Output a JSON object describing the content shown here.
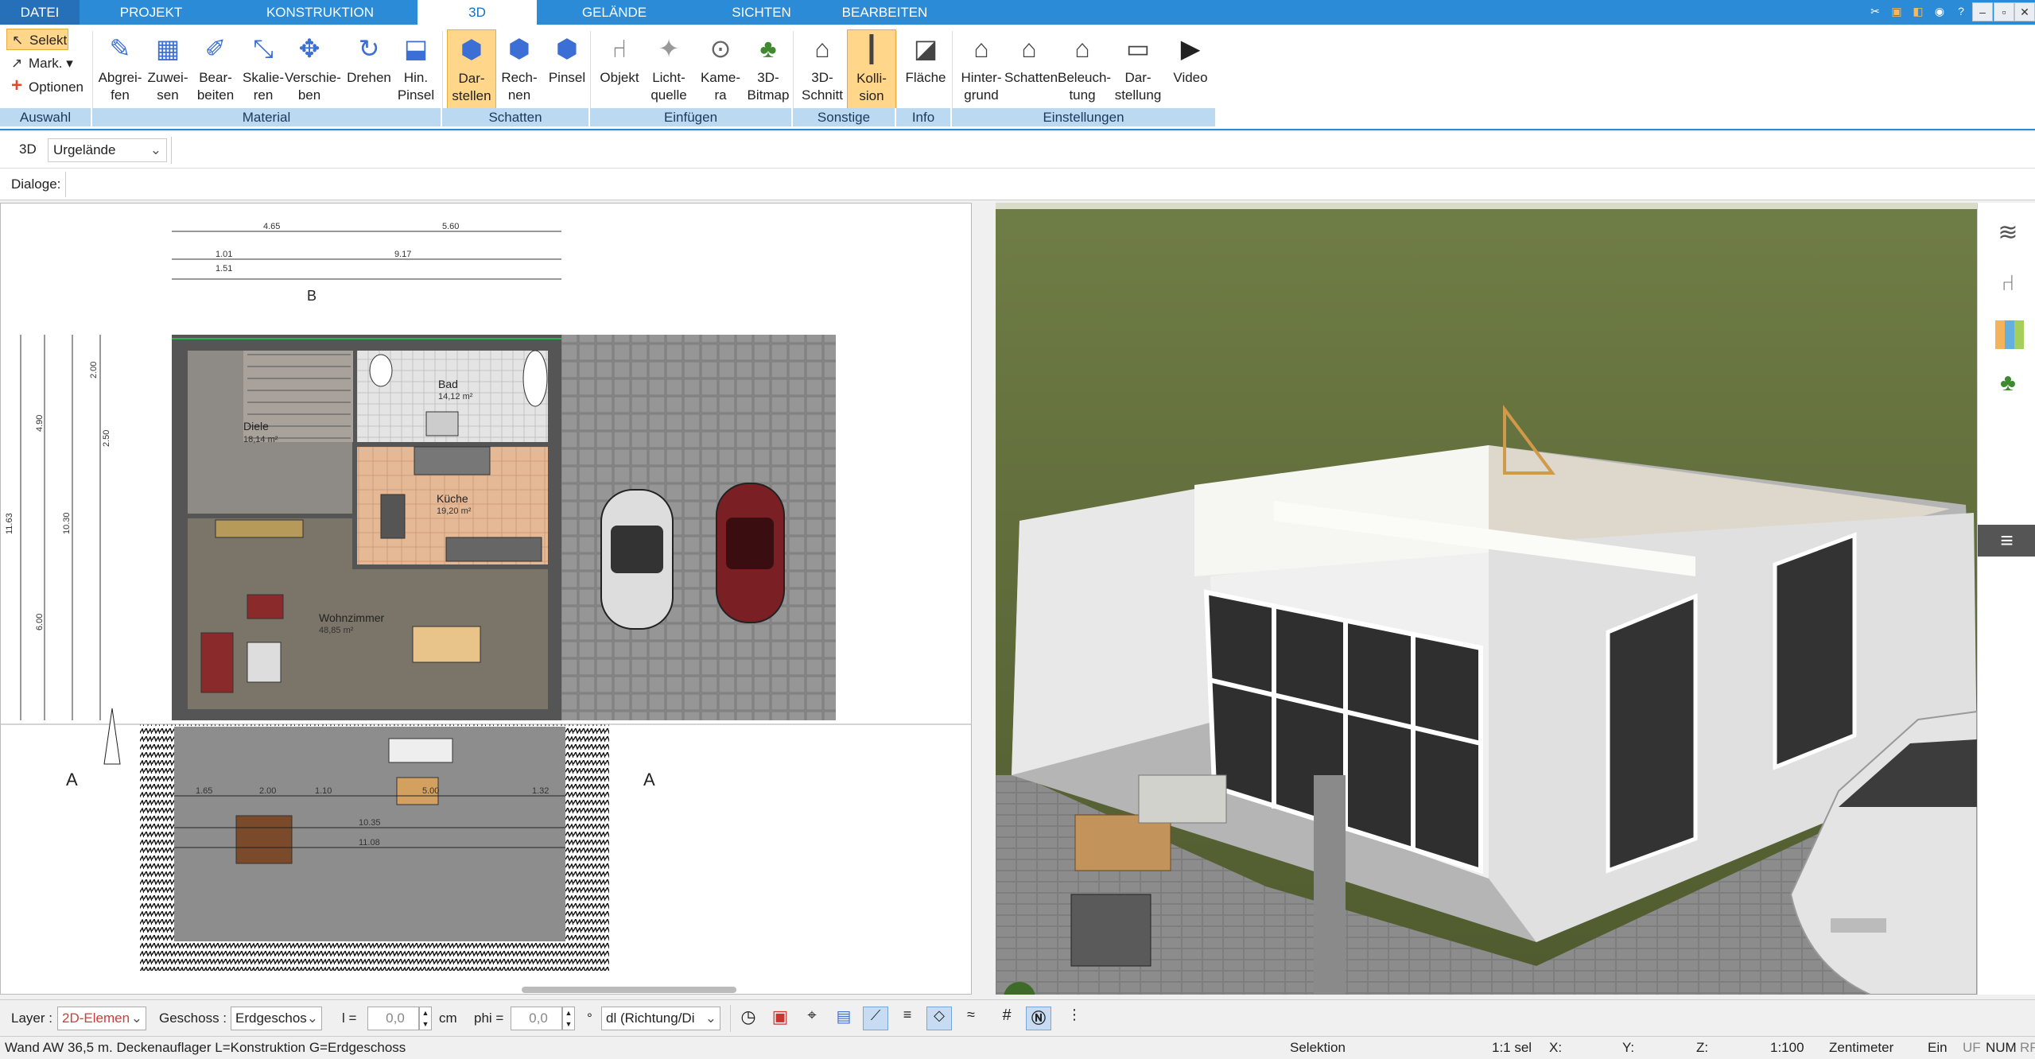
{
  "menu": {
    "tabs": [
      "DATEI",
      "PROJEKT",
      "KONSTRUKTION",
      "3D",
      "GELÄNDE",
      "SICHTEN",
      "BEARBEITEN"
    ],
    "active": "3D"
  },
  "quick_tools": {
    "select": "Selekt",
    "mark": "Mark.",
    "options": "Optionen"
  },
  "ribbon": {
    "buttons": [
      {
        "label1": "Abgrei-",
        "label2": "fen",
        "icon": "eyedropper-icon"
      },
      {
        "label1": "Zuwei-",
        "label2": "sen",
        "icon": "assign-material-icon"
      },
      {
        "label1": "Bear-",
        "label2": "beiten",
        "icon": "edit-material-icon"
      },
      {
        "label1": "Skalie-",
        "label2": "ren",
        "icon": "scale-icon"
      },
      {
        "label1": "Verschie-",
        "label2": "ben",
        "icon": "move-icon"
      },
      {
        "label1": "Drehen",
        "label2": "",
        "icon": "rotate-icon"
      },
      {
        "label1": "Hin.",
        "label2": "Pinsel",
        "icon": "brush-icon"
      },
      {
        "label1": "Dar-",
        "label2": "stellen",
        "icon": "display-shadow-icon"
      },
      {
        "label1": "Rech-",
        "label2": "nen",
        "icon": "calculate-shadow-icon"
      },
      {
        "label1": "Pinsel",
        "label2": "",
        "icon": "shadow-brush-icon"
      },
      {
        "label1": "Objekt",
        "label2": "",
        "icon": "chair-icon"
      },
      {
        "label1": "Licht-",
        "label2": "quelle",
        "icon": "lightbulb-icon"
      },
      {
        "label1": "Kame-",
        "label2": "ra",
        "icon": "camera-icon"
      },
      {
        "label1": "3D-",
        "label2": "Bitmap",
        "icon": "tree-icon"
      },
      {
        "label1": "3D-",
        "label2": "Schnitt",
        "icon": "section-icon"
      },
      {
        "label1": "Kolli-",
        "label2": "sion",
        "icon": "collision-icon"
      },
      {
        "label1": "Fläche",
        "label2": "",
        "icon": "area-icon"
      },
      {
        "label1": "Hinter-",
        "label2": "grund",
        "icon": "background-icon"
      },
      {
        "label1": "Schatten",
        "label2": "",
        "icon": "house-shadow-icon"
      },
      {
        "label1": "Beleuch-",
        "label2": "tung",
        "icon": "house-light-icon"
      },
      {
        "label1": "Dar-",
        "label2": "stellung",
        "icon": "monitor-icon"
      },
      {
        "label1": "Video",
        "label2": "",
        "icon": "play-icon"
      }
    ],
    "groups": [
      "Auswahl",
      "Material",
      "Schatten",
      "Einfügen",
      "Sonstige",
      "Info",
      "Einstellungen"
    ]
  },
  "toolbar2": {
    "mode": "3D",
    "terrain_select": "Urgelände"
  },
  "toolbar3": {
    "dialogs_label": "Dialoge:"
  },
  "plan": {
    "rooms": [
      {
        "name": "Bad",
        "area": "14,12 m²"
      },
      {
        "name": "Diele",
        "area": "18,14 m²"
      },
      {
        "name": "Küche",
        "area": "19,20 m²"
      },
      {
        "name": "Wohnzimmer",
        "area": "48,85 m²"
      }
    ],
    "dims_top": [
      "4.65",
      "5.60",
      "9.17",
      "1.01",
      "1.51"
    ],
    "dims_left": [
      "11.63",
      "4.90",
      "6.00",
      "10.30",
      "2.00",
      "2.50"
    ],
    "section_labels": [
      "A",
      "A",
      "B"
    ],
    "terrace_dims": [
      "1.65",
      "2.00",
      "1.10",
      "5.00",
      "1.32",
      "10.35",
      "11.08"
    ]
  },
  "bottom_toolbar": {
    "layer_label": "Layer :",
    "layer_value": "2D-Elemen",
    "floor_label": "Geschoss :",
    "floor_value": "Erdgeschos",
    "l_label": "l =",
    "l_value": "0,0",
    "unit": "cm",
    "phi_label": "phi =",
    "phi_value": "0,0",
    "deg": "°",
    "direction_value": "dl (Richtung/Di"
  },
  "status": {
    "message": "Wand AW 36,5 m. Deckenauflager L=Konstruktion G=Erdgeschoss",
    "mode": "Selektion",
    "sel": "1:1 sel",
    "x_label": "X:",
    "y_label": "Y:",
    "z_label": "Z:",
    "scale": "1:100",
    "unit": "Zentimeter",
    "ein": "Ein",
    "uf": "UF",
    "num": "NUM",
    "rf": "RF"
  },
  "colors": {
    "accent": "#2b8bd6",
    "ribbon_group": "#bcd9f2",
    "highlight": "#ffd68a",
    "grass": "#5d6b3a"
  }
}
